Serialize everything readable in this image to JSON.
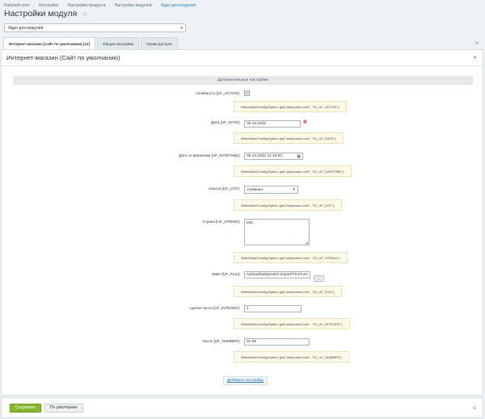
{
  "breadcrumb": [
    "Рабочий стол",
    "Настройки",
    "Настройки продукта",
    "Настройки модулей",
    "Ядро для модулей"
  ],
  "page": {
    "title": "Настройки модуля"
  },
  "site_select": {
    "value": "Ядро для модулей"
  },
  "tabs": [
    {
      "label": "Интернет-магазин (Сайт по умолчанию) [s1]"
    },
    {
      "label": "Общие настройки"
    },
    {
      "label": "Права доступа"
    }
  ],
  "panel": {
    "title": "Интернет-магазин (Сайт по умолчанию)",
    "section": "Дополнительные настройки"
  },
  "fields": {
    "active": {
      "label": "Активность [UF_ACTIVE]:",
      "code": "\\Bitrix\\Main\\Config\\Option::get(\"webprostor.core\", \"S1_UF_ACTIVE\");",
      "checked": true
    },
    "date": {
      "label": "Дата [UF_DATE]:",
      "value": "05.10.2022",
      "code": "\\Bitrix\\Main\\Config\\Option::get(\"webprostor.core\", \"S1_UF_DATE\");"
    },
    "datetime": {
      "label": "Дата со временем [UF_DATETIME]:",
      "value": "05.10.2022 12:10:00",
      "code": "\\Bitrix\\Main\\Config\\Option::get(\"webprostor.core\", \"S1_UF_DATETIME\");"
    },
    "list": {
      "label": "Список [UF_LIST]:",
      "value": "Новинка",
      "code": "\\Bitrix\\Main\\Config\\Option::get(\"webprostor.core\", \"S1_UF_LIST\");"
    },
    "string": {
      "label": "Строка [UF_STRING]:",
      "value": "test",
      "code": "\\Bitrix\\Main\\Config\\Option::get(\"webprostor.core\", \"S1_UF_STRING\");"
    },
    "file": {
      "label": "Файл [UF_FILE]:",
      "value": "/upload/webprostor.import/TEST.xm",
      "browse_label": "...",
      "code": "\\Bitrix\\Main\\Config\\Option::get(\"webprostor.core\", \"S1_UF_FILE\");"
    },
    "integer": {
      "label": "Целое число [UF_INTEGER]:",
      "value": "1",
      "code": "\\Bitrix\\Main\\Config\\Option::get(\"webprostor.core\", \"S1_UF_INTEGER\");"
    },
    "number": {
      "label": "Число [UF_NUMBER]:",
      "value": "31.05",
      "code": "\\Bitrix\\Main\\Config\\Option::get(\"webprostor.core\", \"S1_UF_NUMBER\");"
    }
  },
  "add_setting": "Добавить настройку",
  "footer": {
    "save": "Сохранить",
    "default": "По умолчанию"
  },
  "colors": {
    "save_button": "#88b62c",
    "link": "#2b77b3",
    "code_background": "#fdfaea"
  }
}
